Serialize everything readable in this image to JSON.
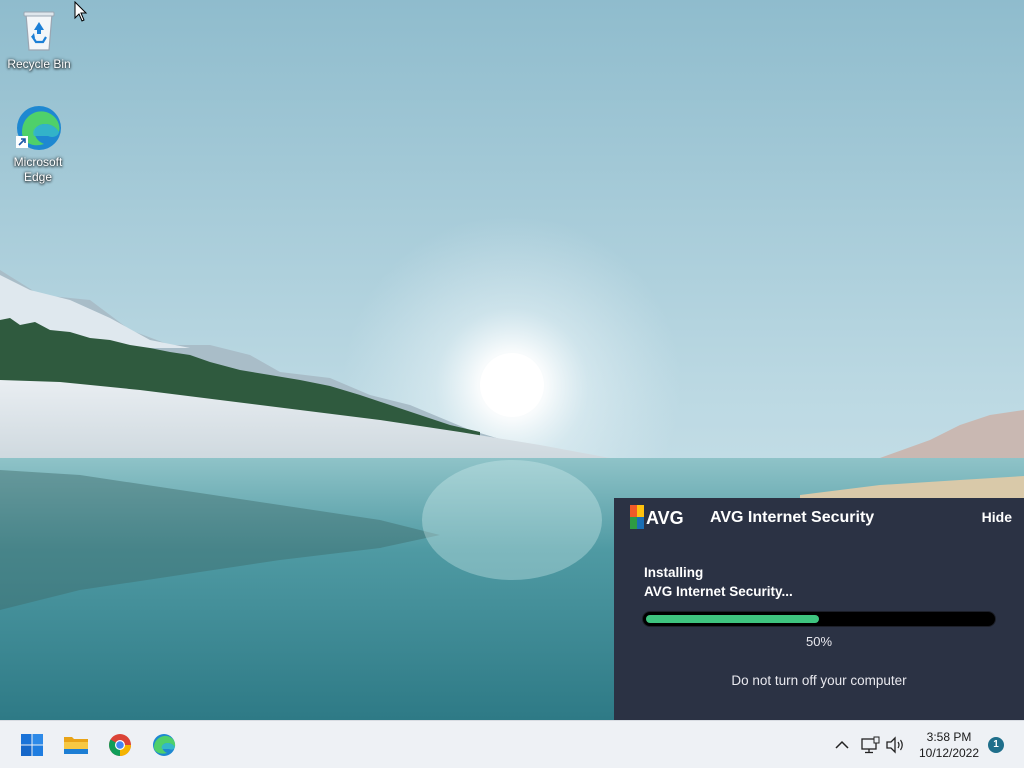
{
  "desktop": {
    "icons": [
      {
        "label": "Recycle Bin",
        "icon": "recycle-bin-icon"
      },
      {
        "label": "Microsoft\nEdge",
        "icon": "microsoft-edge-icon"
      }
    ]
  },
  "avg_popup": {
    "logo_text": "AVG",
    "title": "AVG Internet Security",
    "hide_label": "Hide",
    "status_line1": "Installing",
    "status_line2": "AVG Internet Security...",
    "progress_percent": 50,
    "progress_text": "50%",
    "warning": "Do not turn off your computer",
    "colors": {
      "background": "#2b3244",
      "progress": "#3ec47f",
      "track": "#000000"
    }
  },
  "taskbar": {
    "apps": [
      {
        "name": "Start",
        "icon": "windows-start-icon"
      },
      {
        "name": "File Explorer",
        "icon": "file-explorer-icon"
      },
      {
        "name": "Google Chrome",
        "icon": "chrome-icon"
      },
      {
        "name": "Microsoft Edge",
        "icon": "edge-icon"
      }
    ],
    "tray": {
      "icons": [
        "chevron-up-icon",
        "network-icon",
        "volume-icon"
      ],
      "time": "3:58 PM",
      "date": "10/12/2022",
      "notification_count": "1"
    }
  }
}
